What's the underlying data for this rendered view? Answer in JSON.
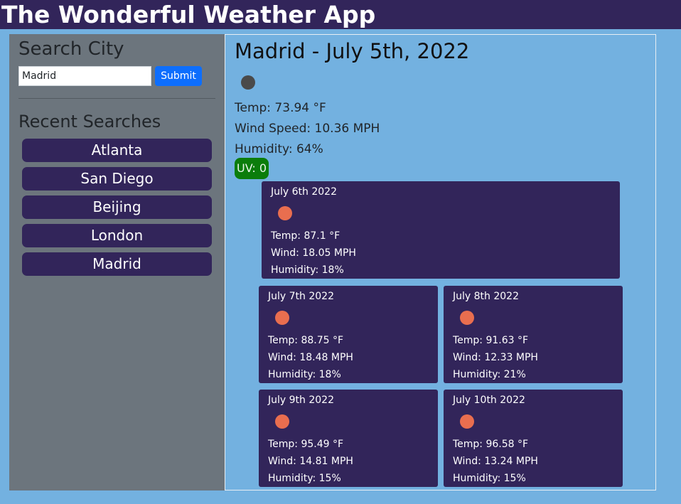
{
  "header": {
    "title": "The Wonderful Weather App"
  },
  "sidebar": {
    "search_heading": "Search City",
    "search_value": "Madrid",
    "submit_label": "Submit",
    "recent_heading": "Recent Searches",
    "recent": [
      "Atlanta",
      "San Diego",
      "Beijing",
      "London",
      "Madrid"
    ]
  },
  "current": {
    "title": "Madrid - July 5th, 2022",
    "icon": "weather-icon",
    "temp": "Temp: 73.94 °F",
    "wind": "Wind Speed: 10.36 MPH",
    "humidity": "Humidity: 64%",
    "uv": "UV: 0",
    "uv_color": "#0b7d0b"
  },
  "forecast": [
    {
      "date": "July 6th 2022",
      "icon": "sun-icon",
      "temp": "Temp: 87.1 °F",
      "wind": "Wind: 18.05 MPH",
      "humidity": "Humidity: 18%"
    },
    {
      "date": "July 7th 2022",
      "icon": "sun-icon",
      "temp": "Temp: 88.75 °F",
      "wind": "Wind: 18.48 MPH",
      "humidity": "Humidity: 18%"
    },
    {
      "date": "July 8th 2022",
      "icon": "sun-icon",
      "temp": "Temp: 91.63 °F",
      "wind": "Wind: 12.33 MPH",
      "humidity": "Humidity: 21%"
    },
    {
      "date": "July 9th 2022",
      "icon": "sun-icon",
      "temp": "Temp: 95.49 °F",
      "wind": "Wind: 14.81 MPH",
      "humidity": "Humidity: 15%"
    },
    {
      "date": "July 10th 2022",
      "icon": "sun-icon",
      "temp": "Temp: 96.58 °F",
      "wind": "Wind: 13.24 MPH",
      "humidity": "Humidity: 15%"
    }
  ]
}
